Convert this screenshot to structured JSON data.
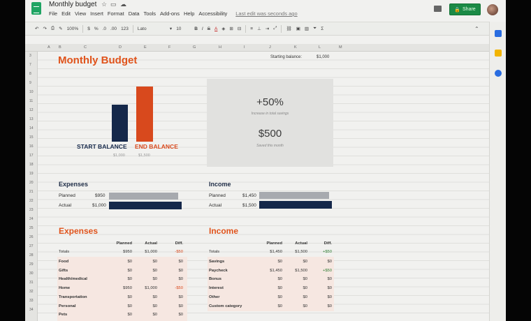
{
  "app": {
    "title": "Monthly budget",
    "menu": [
      "File",
      "Edit",
      "View",
      "Insert",
      "Format",
      "Data",
      "Tools",
      "Add-ons",
      "Help",
      "Accessibility"
    ],
    "last_edit": "Last edit was seconds ago",
    "share_label": "Share"
  },
  "toolbar": {
    "zoom": "100%",
    "currency": "$",
    "percent": "%",
    "decimal_less": ".0",
    "decimal_more": ".00",
    "more_formats": "123",
    "font": "Lato",
    "font_size": "10",
    "bold": "B",
    "italic": "I",
    "strike": "S",
    "text_color": "A"
  },
  "columns": [
    "A",
    "B",
    "C",
    "D",
    "E",
    "F",
    "G",
    "H",
    "I",
    "J",
    "K",
    "L",
    "M"
  ],
  "rows": [
    "3",
    "7",
    "8",
    "9",
    "10",
    "11",
    "12",
    "13",
    "14",
    "15",
    "16",
    "17",
    "18",
    "19",
    "20",
    "21",
    "22",
    "23",
    "24",
    "25",
    "26",
    "27",
    "28",
    "29",
    "30",
    "31",
    "32",
    "33",
    "34"
  ],
  "sheet": {
    "title": "Monthly Budget",
    "starting_balance_label": "Starting balance:",
    "starting_balance_value": "$1,000",
    "chart": {
      "start_label": "START BALANCE",
      "end_label": "END BALANCE",
      "start_value": "$1,000",
      "end_value": "$1,500",
      "start_color": "#15284a",
      "end_color": "#d8491d"
    },
    "savings_pct": "+50%",
    "savings_pct_caption": "Increase in total savings",
    "saved": "$500",
    "saved_caption": "Saved this month",
    "expenses_summary": {
      "title": "Expenses",
      "planned_label": "Planned",
      "planned_value": "$950",
      "actual_label": "Actual",
      "actual_value": "$1,000"
    },
    "income_summary": {
      "title": "Income",
      "planned_label": "Planned",
      "planned_value": "$1,450",
      "actual_label": "Actual",
      "actual_value": "$1,500"
    },
    "expenses_table": {
      "title": "Expenses",
      "headers": [
        "Planned",
        "Actual",
        "Diff."
      ],
      "totals": {
        "label": "Totals",
        "planned": "$950",
        "actual": "$1,000",
        "diff": "-$50"
      },
      "rows": [
        {
          "label": "Food",
          "planned": "$0",
          "actual": "$0",
          "diff": "$0"
        },
        {
          "label": "Gifts",
          "planned": "$0",
          "actual": "$0",
          "diff": "$0"
        },
        {
          "label": "Health/medical",
          "planned": "$0",
          "actual": "$0",
          "diff": "$0"
        },
        {
          "label": "Home",
          "planned": "$950",
          "actual": "$1,000",
          "diff": "-$50"
        },
        {
          "label": "Transportation",
          "planned": "$0",
          "actual": "$0",
          "diff": "$0"
        },
        {
          "label": "Personal",
          "planned": "$0",
          "actual": "$0",
          "diff": "$0"
        },
        {
          "label": "Pets",
          "planned": "$0",
          "actual": "$0",
          "diff": "$0"
        }
      ]
    },
    "income_table": {
      "title": "Income",
      "headers": [
        "Planned",
        "Actual",
        "Diff."
      ],
      "totals": {
        "label": "Totals",
        "planned": "$1,450",
        "actual": "$1,500",
        "diff": "+$50"
      },
      "rows": [
        {
          "label": "Savings",
          "planned": "$0",
          "actual": "$0",
          "diff": "$0"
        },
        {
          "label": "Paycheck",
          "planned": "$1,450",
          "actual": "$1,500",
          "diff": "+$50"
        },
        {
          "label": "Bonus",
          "planned": "$0",
          "actual": "$0",
          "diff": "$0"
        },
        {
          "label": "Interest",
          "planned": "$0",
          "actual": "$0",
          "diff": "$0"
        },
        {
          "label": "Other",
          "planned": "$0",
          "actual": "$0",
          "diff": "$0"
        },
        {
          "label": "Custom category",
          "planned": "$0",
          "actual": "$0",
          "diff": "$0"
        }
      ]
    }
  }
}
